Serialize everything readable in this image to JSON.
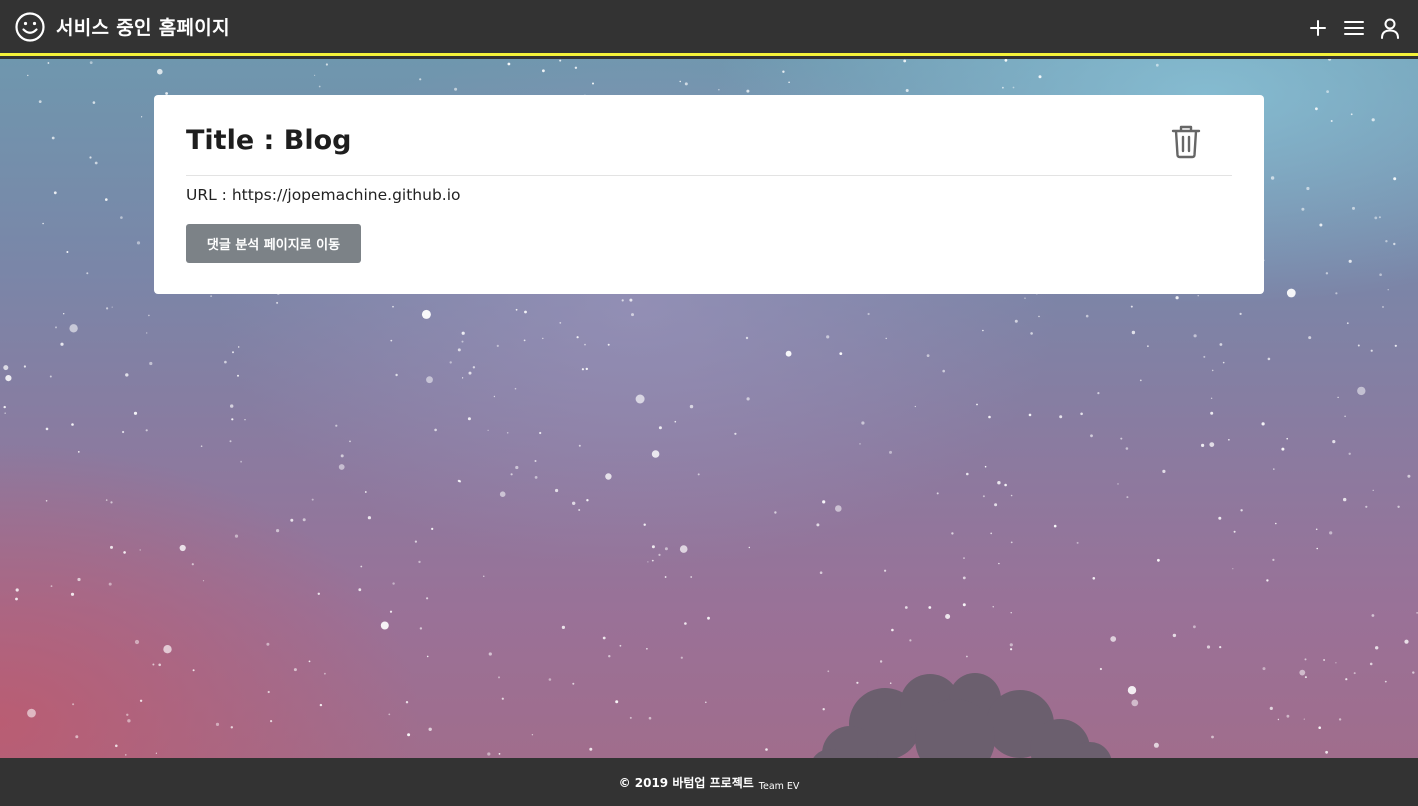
{
  "header": {
    "brand_icon": "smiley-face-icon",
    "title": "서비스 중인 홈페이지",
    "accent_color": "#f5f23a",
    "actions": [
      {
        "icon": "plus-icon"
      },
      {
        "icon": "menu-icon"
      },
      {
        "icon": "user-icon"
      }
    ]
  },
  "card": {
    "title": "Title : Blog",
    "url": "URL : https://jopemachine.github.io",
    "delete_icon": "trash-icon",
    "button_label": "댓글 분석 페이지로 이동"
  },
  "footer": {
    "copyright": "© 2019 바텀업 프로젝트",
    "team": "Team EV"
  },
  "colors": {
    "bar_bg": "#333333",
    "button_bg": "#7c8287"
  }
}
